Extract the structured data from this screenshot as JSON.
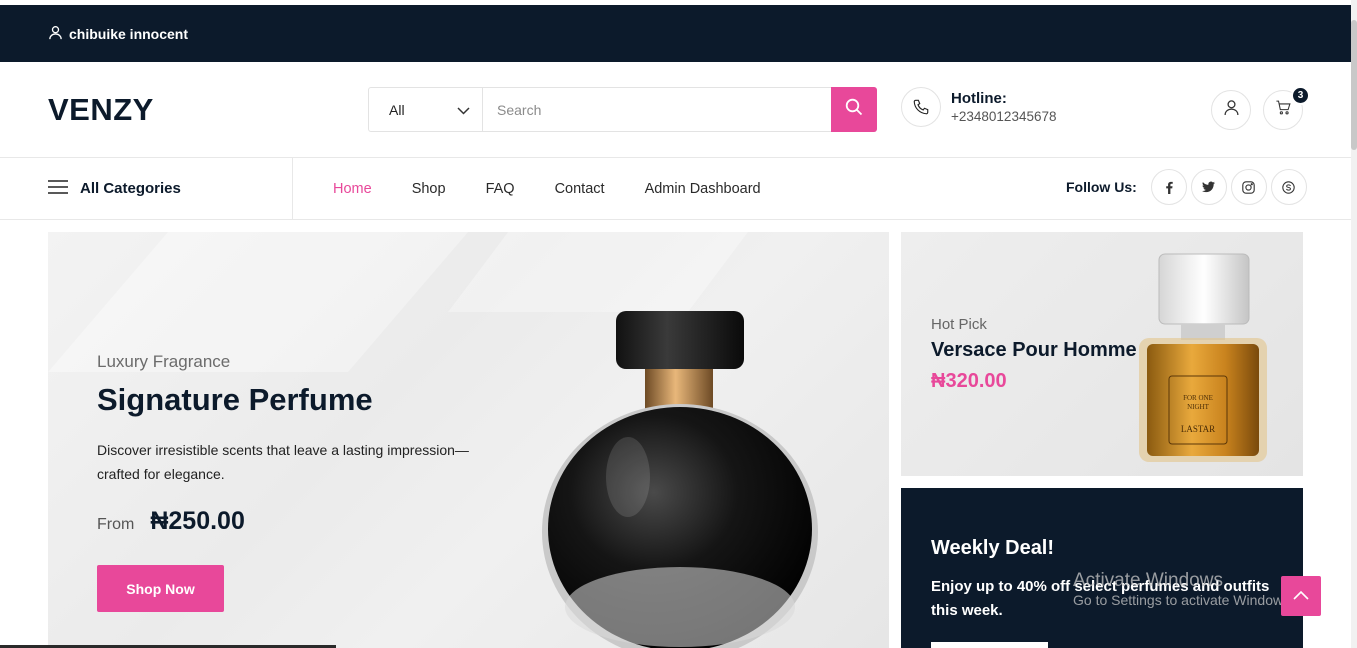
{
  "topbar": {
    "username": "chibuike innocent"
  },
  "header": {
    "logo": "VENZY",
    "category_select": "All",
    "search_placeholder": "Search",
    "hotline_label": "Hotline:",
    "hotline_number": "+2348012345678",
    "cart_count": "3"
  },
  "nav": {
    "all_categories": "All Categories",
    "items": [
      {
        "label": "Home",
        "active": true
      },
      {
        "label": "Shop",
        "active": false
      },
      {
        "label": "FAQ",
        "active": false
      },
      {
        "label": "Contact",
        "active": false
      },
      {
        "label": "Admin Dashboard",
        "active": false
      }
    ],
    "follow_label": "Follow Us:",
    "social_icons": [
      "facebook-icon",
      "twitter-icon",
      "instagram-icon",
      "skype-icon"
    ]
  },
  "hero": {
    "subtitle": "Luxury Fragrance",
    "title": "Signature Perfume",
    "description": "Discover irresistible scents that leave a lasting impression—crafted for elegance.",
    "from_label": "From",
    "price": "₦250.00",
    "button": "Shop Now"
  },
  "hot_pick": {
    "subtitle": "Hot Pick",
    "title": "Versace Pour Homme",
    "price": "₦320.00"
  },
  "weekly_deal": {
    "title": "Weekly Deal!",
    "description": "Enjoy up to 40% off select perfumes and outfits this week."
  },
  "watermark": {
    "line1": "Activate Windows",
    "line2": "Go to Settings to activate Windows."
  },
  "colors": {
    "accent": "#e8489a",
    "dark": "#0c1a2b"
  }
}
